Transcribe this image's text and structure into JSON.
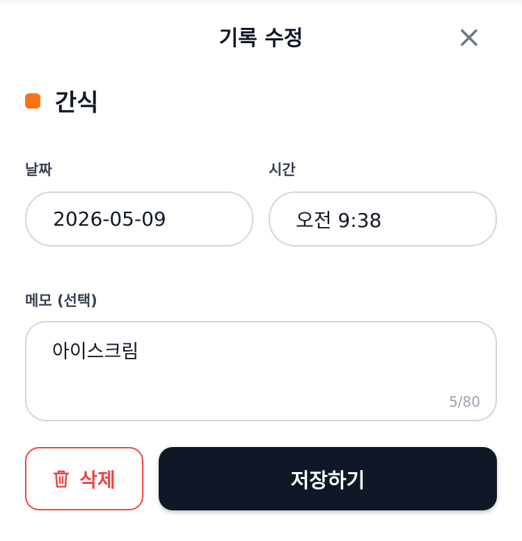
{
  "header": {
    "title": "기록 수정",
    "close_icon": "close-icon"
  },
  "category": {
    "label": "간식",
    "color": "#f97316"
  },
  "date": {
    "label": "날짜",
    "value": "2026-05-09"
  },
  "time": {
    "label": "시간",
    "value": "오전 9:38"
  },
  "memo": {
    "label": "메모 (선택)",
    "value": "아이스크림",
    "count": "5/80"
  },
  "actions": {
    "delete_label": "삭제",
    "delete_icon": "trash-icon",
    "save_label": "저장하기"
  },
  "colors": {
    "danger": "#ef4444",
    "primary": "#101827",
    "border": "#cfd6e0"
  }
}
